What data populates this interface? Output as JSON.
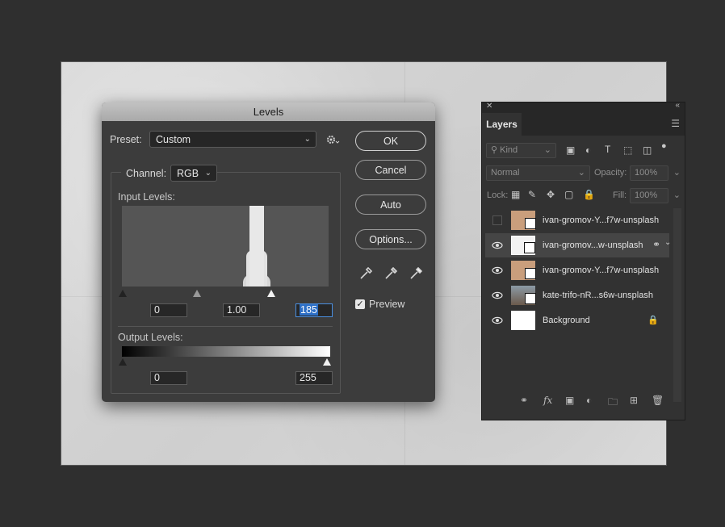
{
  "dialog": {
    "title": "Levels",
    "preset_label": "Preset:",
    "preset_value": "Custom",
    "channel_label": "Channel:",
    "channel_value": "RGB",
    "input_levels_label": "Input Levels:",
    "output_levels_label": "Output Levels:",
    "input_black": "0",
    "input_gamma": "1.00",
    "input_white": "185",
    "output_black": "0",
    "output_white": "255",
    "buttons": {
      "ok": "OK",
      "cancel": "Cancel",
      "auto": "Auto",
      "options": "Options..."
    },
    "preview_label": "Preview",
    "preview_checked": true
  },
  "layers_panel": {
    "tab": "Layers",
    "filter_kind": "Kind",
    "blend_mode": "Normal",
    "opacity_label": "Opacity:",
    "opacity_value": "100%",
    "lock_label": "Lock:",
    "fill_label": "Fill:",
    "fill_value": "100%",
    "layers": [
      {
        "name": "ivan-gromov-Y...f7w-unsplash",
        "visible": false,
        "selected": false,
        "thumb": "#c99e7c"
      },
      {
        "name": "ivan-gromov...w-unsplash",
        "visible": true,
        "selected": true,
        "thumb": "#f2f2f2"
      },
      {
        "name": "ivan-gromov-Y...f7w-unsplash",
        "visible": true,
        "selected": false,
        "thumb": "#c99e7c"
      },
      {
        "name": "kate-trifo-nR...s6w-unsplash",
        "visible": true,
        "selected": false,
        "thumb": "#7d6a5a"
      },
      {
        "name": "Background",
        "visible": true,
        "selected": false,
        "thumb": "#ffffff",
        "locked": true
      }
    ]
  },
  "colors": {
    "accent": "#2d6fc6",
    "dialog_bg": "#3c3c3c",
    "panel_bg": "#323232"
  }
}
